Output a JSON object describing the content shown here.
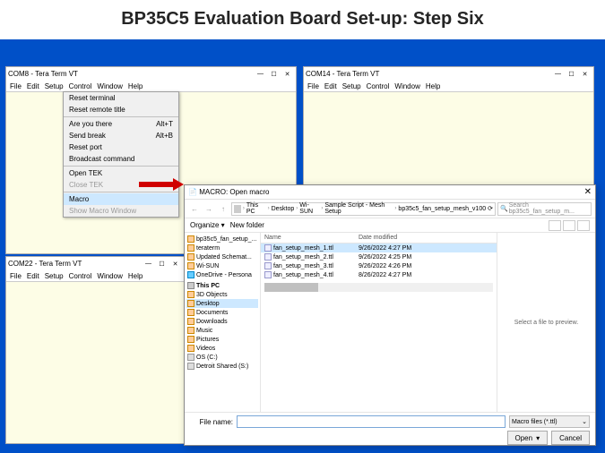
{
  "page_title": "BP35C5 Evaluation Board Set-up: Step Six",
  "term": {
    "t1_title": "COM8 - Tera Term VT",
    "t2_title": "COM14 - Tera Term VT",
    "t3_title": "COM22 - Tera Term VT",
    "menu": {
      "file": "File",
      "edit": "Edit",
      "setup": "Setup",
      "control": "Control",
      "window": "Window",
      "help": "Help"
    },
    "win": {
      "min": "—",
      "max": "☐",
      "close": "✕"
    }
  },
  "dropdown": {
    "reset_terminal": "Reset terminal",
    "reset_remote_title": "Reset remote title",
    "are_you_there": "Are you there",
    "are_you_there_accel": "Alt+T",
    "send_break": "Send break",
    "send_break_accel": "Alt+B",
    "reset_port": "Reset port",
    "broadcast": "Broadcast command",
    "open_tek": "Open TEK",
    "close_tek": "Close TEK",
    "macro": "Macro",
    "show_macro": "Show Macro Window"
  },
  "dlg": {
    "title": "MACRO: Open macro",
    "close": "✕",
    "nav": {
      "back": "←",
      "fwd": "→",
      "up": "↑",
      "refresh": "⟳"
    },
    "breadcrumb": [
      "This PC",
      "Desktop",
      "Wi-SUN",
      "Sample Script - Mesh Setup",
      "bp35c5_fan_setup_mesh_v100"
    ],
    "search_placeholder": "Search bp35c5_fan_setup_m...",
    "toolbar": {
      "organize": "Organize ▾",
      "newfolder": "New folder"
    },
    "navpane": [
      {
        "label": "bp35c5_fan_setup_...",
        "icon": "folder"
      },
      {
        "label": "teraterm",
        "icon": "folder"
      },
      {
        "label": "Updated Schemat...",
        "icon": "folder"
      },
      {
        "label": "Wi-SUN",
        "icon": "folder"
      },
      {
        "label": "OneDrive - Persona",
        "icon": "blue"
      },
      {
        "label": "This PC",
        "icon": "pc",
        "hdr": true
      },
      {
        "label": "3D Objects",
        "icon": "folder"
      },
      {
        "label": "Desktop",
        "icon": "folder",
        "sel": true
      },
      {
        "label": "Documents",
        "icon": "folder"
      },
      {
        "label": "Downloads",
        "icon": "folder"
      },
      {
        "label": "Music",
        "icon": "folder"
      },
      {
        "label": "Pictures",
        "icon": "folder"
      },
      {
        "label": "Videos",
        "icon": "folder"
      },
      {
        "label": "OS (C:)",
        "icon": "drive"
      },
      {
        "label": "Detroit Shared (S:)",
        "icon": "drive"
      }
    ],
    "cols": {
      "name": "Name",
      "date": "Date modified"
    },
    "files": [
      {
        "name": "fan_setup_mesh_1.ttl",
        "date": "9/26/2022 4:27 PM",
        "sel": true
      },
      {
        "name": "fan_setup_mesh_2.ttl",
        "date": "9/26/2022 4:25 PM"
      },
      {
        "name": "fan_setup_mesh_3.ttl",
        "date": "9/26/2022 4:26 PM"
      },
      {
        "name": "fan_setup_mesh_4.ttl",
        "date": "8/26/2022 4:27 PM"
      }
    ],
    "preview": "Select a file to preview.",
    "filename_label": "File name:",
    "filename_value": "",
    "filter": "Macro files (*.ttl)",
    "btn_open": "Open",
    "btn_open_drop": "▾",
    "btn_cancel": "Cancel"
  }
}
